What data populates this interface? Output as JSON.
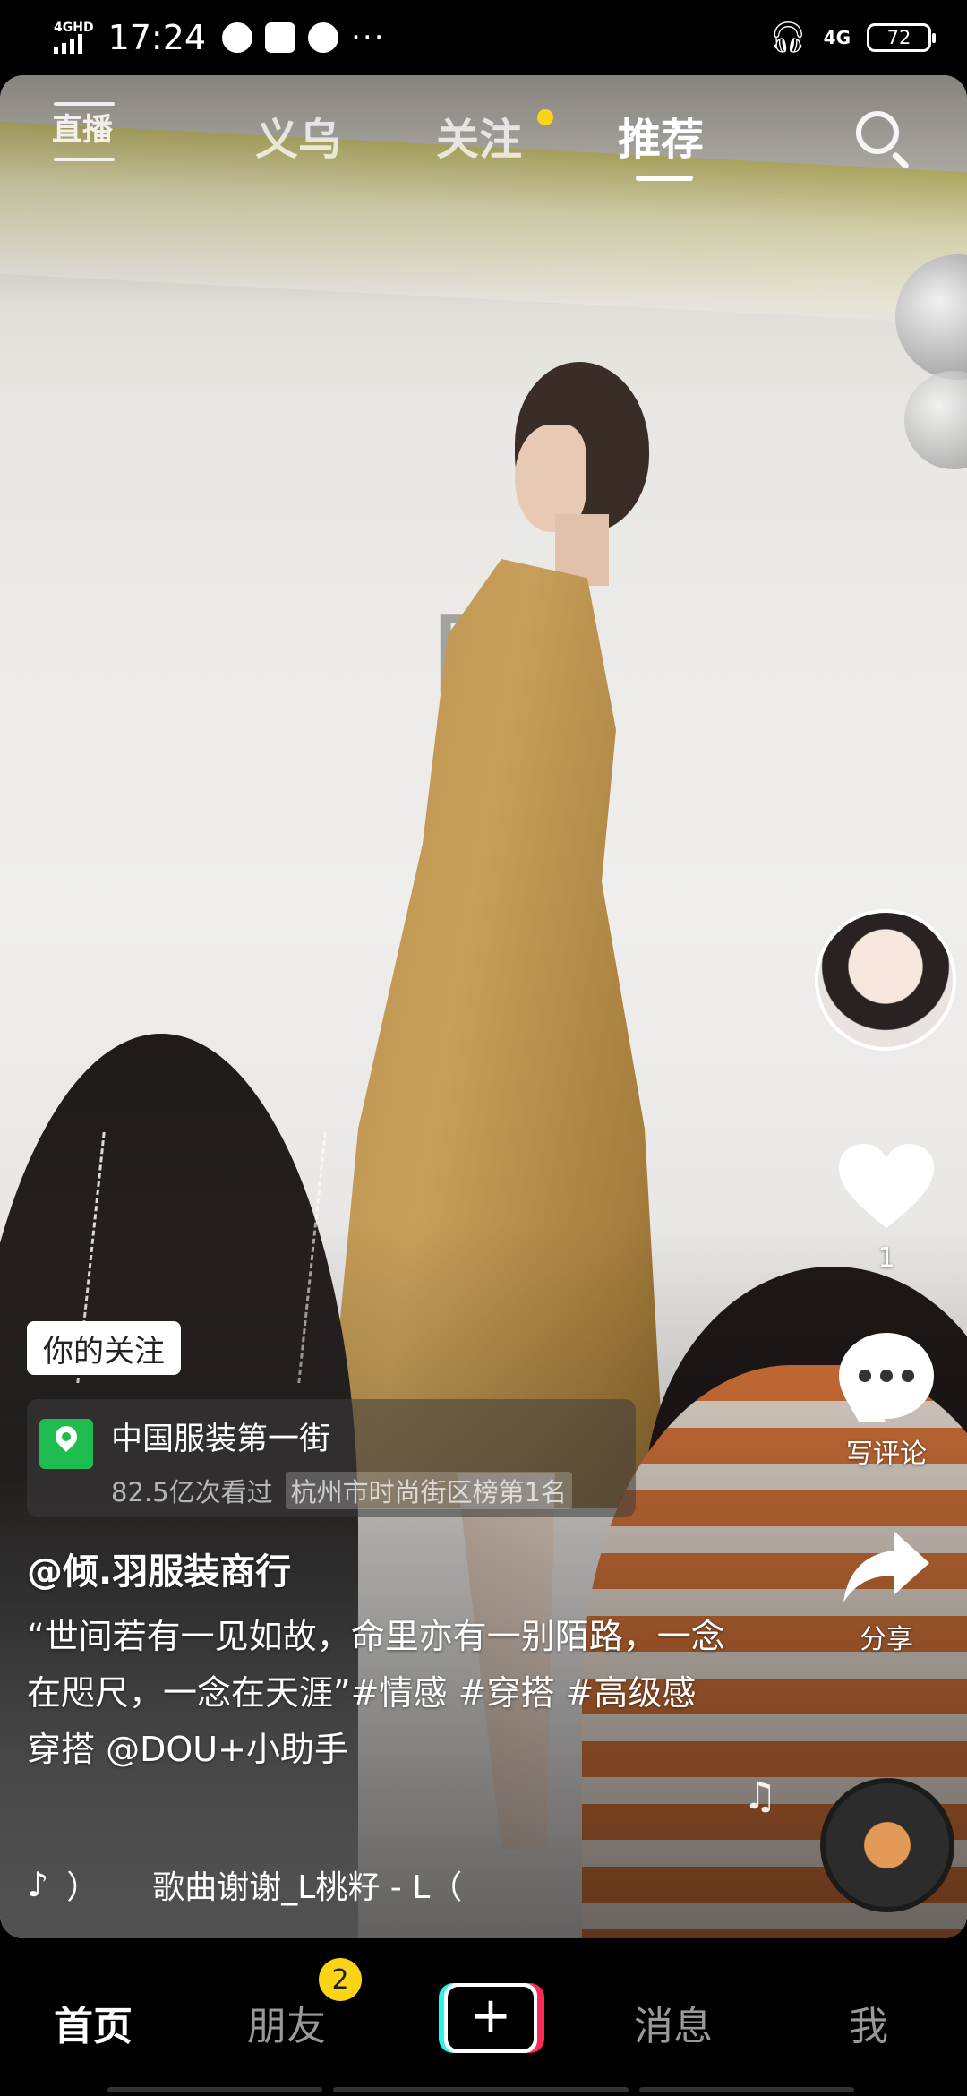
{
  "status_bar": {
    "network_label": "4GHD",
    "time": "17:24",
    "more": "···",
    "cell_label": "4G",
    "battery": "72"
  },
  "top_nav": {
    "live_label": "直播",
    "tabs": [
      "义乌",
      "关注",
      "推荐"
    ],
    "active_tab": "推荐"
  },
  "right_rail": {
    "like_count": "1",
    "comment_label": "写评论",
    "share_label": "分享"
  },
  "video_info": {
    "follow_tag": "你的关注",
    "poi": {
      "name": "中国服装第一街",
      "views": "82.5亿次看过",
      "rank": "杭州市时尚街区榜第1名"
    },
    "author": "@倾.羽服装商行",
    "caption": "“世间若有一见如故，命里亦有一别陌路，一念在咫尺，一念在天涯”#情感 #穿搭 #高级感穿搭 @DOU+小助手",
    "music_paren": "）",
    "music_text": "歌曲谢谢_L桃籽 - L（"
  },
  "bottom_tabs": {
    "home": "首页",
    "friends": "朋友",
    "friends_badge": "2",
    "add": "+",
    "messages": "消息",
    "me": "我"
  },
  "colors": {
    "accent_yellow": "#fcd417",
    "poi_green": "#1fbd4f",
    "add_cyan": "#25f4ee",
    "add_red": "#fe2c55"
  }
}
